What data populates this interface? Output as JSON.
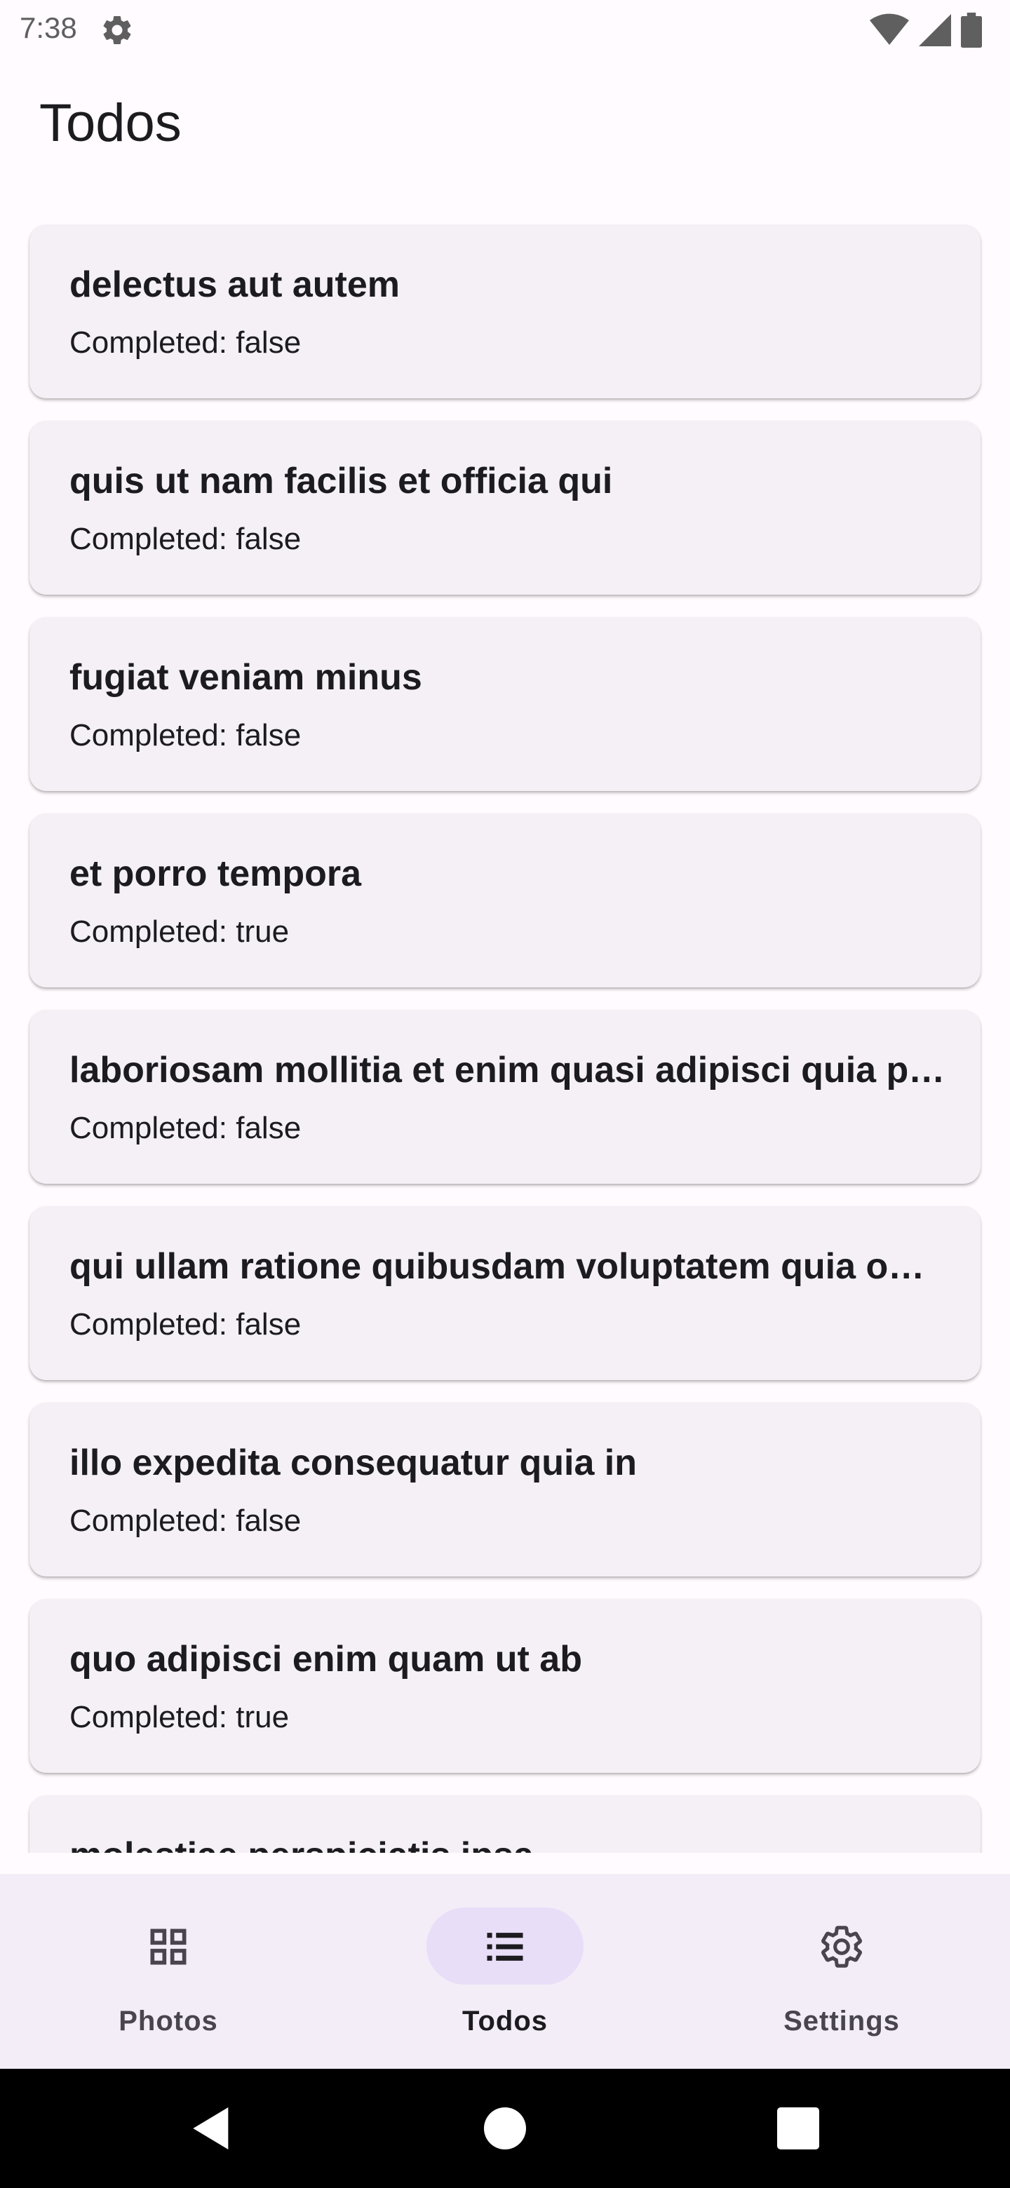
{
  "status_bar": {
    "time": "7:38",
    "icons": [
      "settings-icon",
      "wifi-icon",
      "signal-icon",
      "battery-icon"
    ]
  },
  "app_bar": {
    "title": "Todos"
  },
  "todos": [
    {
      "title": "delectus aut autem",
      "status": "Completed: false"
    },
    {
      "title": "quis ut nam facilis et officia qui",
      "status": "Completed: false"
    },
    {
      "title": "fugiat veniam minus",
      "status": "Completed: false"
    },
    {
      "title": "et porro tempora",
      "status": "Completed: true"
    },
    {
      "title": "laboriosam mollitia et enim quasi adipisci quia provident illum",
      "status": "Completed: false"
    },
    {
      "title": "qui ullam ratione quibusdam voluptatem quia omnis",
      "status": "Completed: false"
    },
    {
      "title": "illo expedita consequatur quia in",
      "status": "Completed: false"
    },
    {
      "title": "quo adipisci enim quam ut ab",
      "status": "Completed: true"
    },
    {
      "title": "molestiae perspiciatis ipsa",
      "status": ""
    }
  ],
  "bottom_nav": {
    "items": [
      {
        "label": "Photos",
        "icon": "grid-icon",
        "active": false
      },
      {
        "label": "Todos",
        "icon": "list-icon",
        "active": true
      },
      {
        "label": "Settings",
        "icon": "gear-icon",
        "active": false
      }
    ]
  },
  "colors": {
    "background": "#fffbfe",
    "card": "#f4f0f6",
    "nav_background": "#f3edf7",
    "nav_active_pill": "#e8def8",
    "text": "#1c1b1f"
  }
}
